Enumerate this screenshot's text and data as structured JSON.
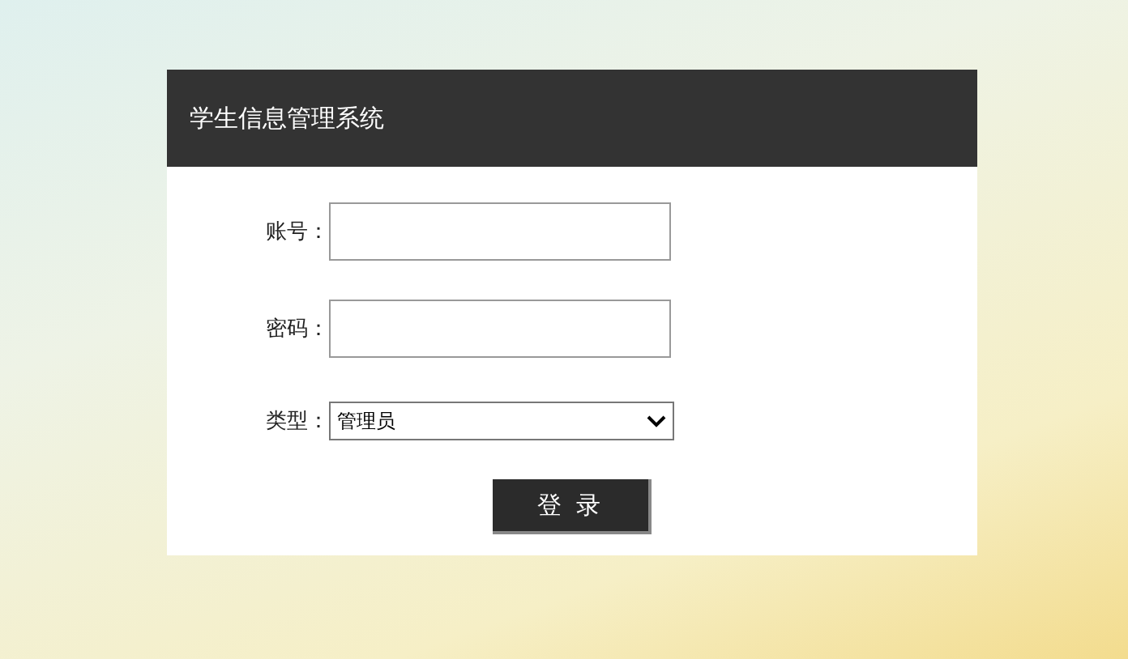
{
  "header": {
    "title": "学生信息管理系统"
  },
  "fields": [
    {
      "kind": "text",
      "label": "账号："
    },
    {
      "kind": "password",
      "label": "密码："
    },
    {
      "kind": "select",
      "label": "类型：",
      "value": "管理员"
    }
  ],
  "login_button": {
    "label": "登 录"
  }
}
